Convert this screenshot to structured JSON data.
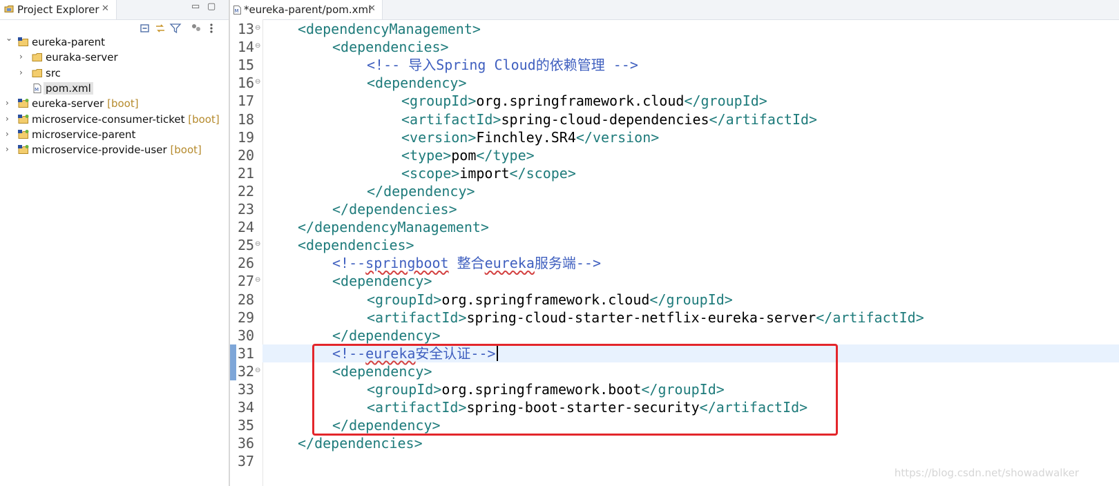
{
  "explorer": {
    "tab_label": "Project Explorer",
    "close_glyph": "✕",
    "minimize_glyph": "▭",
    "maximize_glyph": "▢",
    "toolbar": [
      "collapse-all-icon",
      "link-with-editor-icon",
      "filter-icon",
      "group-icon",
      "view-menu-icon"
    ],
    "tree": [
      {
        "label": "eureka-parent",
        "decoration": "",
        "depth": 0,
        "expanded": true,
        "icon": "project-icon"
      },
      {
        "label": "euraka-server",
        "decoration": "",
        "depth": 1,
        "expanded": false,
        "icon": "folder-icon"
      },
      {
        "label": "src",
        "decoration": "",
        "depth": 1,
        "expanded": false,
        "icon": "folder-icon"
      },
      {
        "label": "pom.xml",
        "decoration": "",
        "depth": 1,
        "leaf": true,
        "selected": true,
        "icon": "xml-file-icon"
      },
      {
        "label": "eureka-server",
        "decoration": "[boot]",
        "depth": 0,
        "expanded": false,
        "icon": "boot-project-icon"
      },
      {
        "label": "microservice-consumer-ticket",
        "decoration": "[boot]",
        "depth": 0,
        "expanded": false,
        "icon": "boot-project-icon"
      },
      {
        "label": "microservice-parent",
        "decoration": "",
        "depth": 0,
        "expanded": false,
        "icon": "boot-project-icon"
      },
      {
        "label": "microservice-provide-user",
        "decoration": "[boot]",
        "depth": 0,
        "expanded": false,
        "icon": "boot-project-icon"
      }
    ]
  },
  "editor": {
    "tab_label": "*eureka-parent/pom.xml",
    "close_glyph": "✕",
    "current_line": 31,
    "lines": [
      {
        "n": "13",
        "fold": "⊖",
        "indent": 1,
        "tokens": [
          {
            "c": "tag",
            "t": "<dependencyManagement>"
          }
        ]
      },
      {
        "n": "14",
        "fold": "⊖",
        "indent": 2,
        "tokens": [
          {
            "c": "tag",
            "t": "<dependencies>"
          }
        ]
      },
      {
        "n": "15",
        "fold": "",
        "indent": 3,
        "tokens": [
          {
            "c": "com",
            "t": "<!-- 导入Spring Cloud的依赖管理 -->"
          }
        ]
      },
      {
        "n": "16",
        "fold": "⊖",
        "indent": 3,
        "tokens": [
          {
            "c": "tag",
            "t": "<dependency>"
          }
        ]
      },
      {
        "n": "17",
        "fold": "",
        "indent": 4,
        "tokens": [
          {
            "c": "tag",
            "t": "<groupId>"
          },
          {
            "c": "txt",
            "t": "org.springframework.cloud"
          },
          {
            "c": "tag",
            "t": "</groupId>"
          }
        ]
      },
      {
        "n": "18",
        "fold": "",
        "indent": 4,
        "tokens": [
          {
            "c": "tag",
            "t": "<artifactId>"
          },
          {
            "c": "txt",
            "t": "spring-cloud-dependencies"
          },
          {
            "c": "tag",
            "t": "</artifactId>"
          }
        ]
      },
      {
        "n": "19",
        "fold": "",
        "indent": 4,
        "tokens": [
          {
            "c": "tag",
            "t": "<version>"
          },
          {
            "c": "txt",
            "t": "Finchley.SR4"
          },
          {
            "c": "tag",
            "t": "</version>"
          }
        ]
      },
      {
        "n": "20",
        "fold": "",
        "indent": 4,
        "tokens": [
          {
            "c": "tag",
            "t": "<type>"
          },
          {
            "c": "txt",
            "t": "pom"
          },
          {
            "c": "tag",
            "t": "</type>"
          }
        ]
      },
      {
        "n": "21",
        "fold": "",
        "indent": 4,
        "tokens": [
          {
            "c": "tag",
            "t": "<scope>"
          },
          {
            "c": "txt",
            "t": "import"
          },
          {
            "c": "tag",
            "t": "</scope>"
          }
        ]
      },
      {
        "n": "22",
        "fold": "",
        "indent": 3,
        "tokens": [
          {
            "c": "tag",
            "t": "</dependency>"
          }
        ]
      },
      {
        "n": "23",
        "fold": "",
        "indent": 2,
        "tokens": [
          {
            "c": "tag",
            "t": "</dependencies>"
          }
        ]
      },
      {
        "n": "24",
        "fold": "",
        "indent": 1,
        "tokens": [
          {
            "c": "tag",
            "t": "</dependencyManagement>"
          }
        ]
      },
      {
        "n": "25",
        "fold": "⊖",
        "indent": 1,
        "tokens": [
          {
            "c": "tag",
            "t": "<dependencies>"
          }
        ]
      },
      {
        "n": "26",
        "fold": "",
        "indent": 2,
        "tokens": [
          {
            "c": "com",
            "t": "<!--"
          },
          {
            "c": "com",
            "t": "springboot",
            "ul": true
          },
          {
            "c": "com",
            "t": " 整合"
          },
          {
            "c": "com",
            "t": "eureka",
            "ul": true
          },
          {
            "c": "com",
            "t": "服务端-->"
          }
        ]
      },
      {
        "n": "27",
        "fold": "⊖",
        "indent": 2,
        "tokens": [
          {
            "c": "tag",
            "t": "<dependency>"
          }
        ]
      },
      {
        "n": "28",
        "fold": "",
        "indent": 3,
        "tokens": [
          {
            "c": "tag",
            "t": "<groupId>"
          },
          {
            "c": "txt",
            "t": "org.springframework.cloud"
          },
          {
            "c": "tag",
            "t": "</groupId>"
          }
        ]
      },
      {
        "n": "29",
        "fold": "",
        "indent": 3,
        "tokens": [
          {
            "c": "tag",
            "t": "<artifactId>"
          },
          {
            "c": "txt",
            "t": "spring-cloud-starter-netflix-eureka-server"
          },
          {
            "c": "tag",
            "t": "</artifactId>"
          }
        ]
      },
      {
        "n": "30",
        "fold": "",
        "indent": 2,
        "tokens": [
          {
            "c": "tag",
            "t": "</dependency>"
          }
        ]
      },
      {
        "n": "31",
        "fold": "",
        "indent": 2,
        "mark": true,
        "tokens": [
          {
            "c": "com",
            "t": "<!--"
          },
          {
            "c": "com",
            "t": "eureka",
            "ul": true
          },
          {
            "c": "com",
            "t": "安全认证-->"
          }
        ]
      },
      {
        "n": "32",
        "fold": "⊖",
        "indent": 2,
        "mark": true,
        "tokens": [
          {
            "c": "tag",
            "t": "<dependency>"
          }
        ]
      },
      {
        "n": "33",
        "fold": "",
        "indent": 3,
        "tokens": [
          {
            "c": "tag",
            "t": "<groupId>"
          },
          {
            "c": "txt",
            "t": "org.springframework.boot"
          },
          {
            "c": "tag",
            "t": "</groupId>"
          }
        ]
      },
      {
        "n": "34",
        "fold": "",
        "indent": 3,
        "tokens": [
          {
            "c": "tag",
            "t": "<artifactId>"
          },
          {
            "c": "txt",
            "t": "spring-boot-starter-security"
          },
          {
            "c": "tag",
            "t": "</artifactId>"
          }
        ]
      },
      {
        "n": "35",
        "fold": "",
        "indent": 2,
        "tokens": [
          {
            "c": "tag",
            "t": "</dependency>"
          }
        ]
      },
      {
        "n": "36",
        "fold": "",
        "indent": 1,
        "tokens": [
          {
            "c": "tag",
            "t": "</dependencies>"
          }
        ]
      },
      {
        "n": "37",
        "fold": "",
        "indent": 0,
        "tokens": []
      }
    ]
  },
  "watermark": "https://blog.csdn.net/showadwalker",
  "colors": {
    "tag": "#1e7b7b",
    "comment": "#3f5fbf",
    "text": "#000000",
    "highlight_box": "#e3262b",
    "current_line": "#e8f2fe",
    "decoration": "#b58a2c"
  }
}
